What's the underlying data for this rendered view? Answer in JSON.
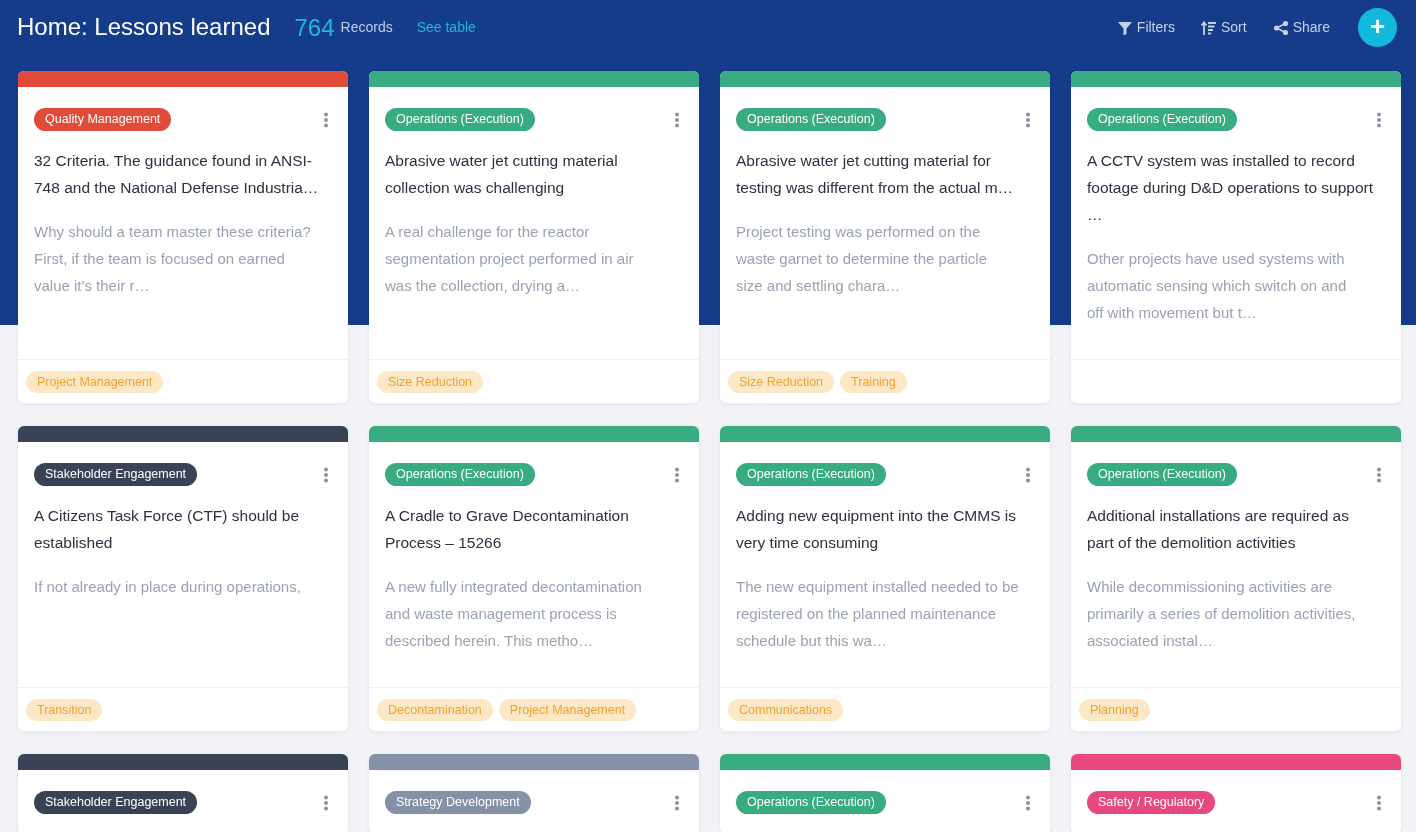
{
  "header": {
    "title": "Home: Lessons learned",
    "count": "764",
    "count_label": "Records",
    "link": "See table"
  },
  "toolbar": [
    {
      "kind": "filter",
      "label": "Filters"
    },
    {
      "kind": "sort",
      "label": "Sort"
    },
    {
      "kind": "share",
      "label": "Share"
    }
  ],
  "add_button": {
    "label": "+"
  },
  "cards": [
    {
      "color": "#e04b3a",
      "category": "Quality Management",
      "title_lines": [
        "32 Criteria. The guidance found in ANSI-",
        "748 and the National Defense Industria…"
      ],
      "description_lines": [
        "Why should a team master these criteria?",
        "First, if the team is focused on earned",
        "value it's their r…"
      ],
      "tags": [
        "Project Management"
      ]
    },
    {
      "color": "#39ab80",
      "category": "Operations (Execution)",
      "title_lines": [
        "Abrasive water jet cutting material",
        "collection was challenging"
      ],
      "description_lines": [
        "A real challenge for the reactor",
        "segmentation project performed in air",
        "was the collection, drying a…"
      ],
      "tags": [
        "Size Reduction"
      ]
    },
    {
      "color": "#39ab80",
      "category": "Operations (Execution)",
      "title_lines": [
        "Abrasive water jet cutting material for",
        "testing was different from the actual m…"
      ],
      "description_lines": [
        "Project testing was performed on the",
        "waste garnet to determine the particle",
        "size and settling chara…"
      ],
      "tags": [
        "Size Reduction",
        "Training"
      ]
    },
    {
      "color": "#39ab80",
      "category": "Operations (Execution)",
      "title_lines": [
        "A CCTV system was installed to record",
        "footage during D&D operations to support",
        "…"
      ],
      "description_lines": [
        "Other projects have used systems with",
        "automatic sensing which switch on and",
        "off with movement but t…"
      ]
    },
    {
      "color": "#3a4356",
      "category": "Stakeholder Engagement",
      "title_lines": [
        "A Citizens Task Force (CTF) should be",
        "established"
      ],
      "description_lines": [
        "If not already in place during operations,"
      ],
      "tags": [
        "Transition"
      ]
    },
    {
      "color": "#39ab80",
      "category": "Operations (Execution)",
      "title_lines": [
        "A Cradle to Grave Decontamination",
        "Process – 15266"
      ],
      "description_lines": [
        "A new fully integrated decontamination",
        "and waste management process is",
        "described herein. This metho…"
      ],
      "tags": [
        "Decontamination",
        "Project Management"
      ]
    },
    {
      "color": "#39ab80",
      "category": "Operations (Execution)",
      "title_lines": [
        "Adding new equipment into the CMMS is",
        "very time consuming"
      ],
      "description_lines": [
        "The new equipment installed needed to be",
        "registered on the planned maintenance",
        "schedule but this wa…"
      ],
      "tags": [
        "Communications"
      ]
    },
    {
      "color": "#39ab80",
      "category": "Operations (Execution)",
      "title_lines": [
        "Additional installations are required as",
        "part of the demolition activities"
      ],
      "description_lines": [
        "While decommissioning activities are",
        "primarily a series of demolition activities,",
        "associated instal…"
      ],
      "tags": [
        "Planning"
      ]
    },
    {
      "color": "#3a4356",
      "category": "Stakeholder Engagement"
    },
    {
      "color": "#8591a6",
      "category": "Strategy Development"
    },
    {
      "color": "#39ab80",
      "category": "Operations (Execution)"
    },
    {
      "color": "#e8497d",
      "category": "Safety / Regulatory"
    }
  ]
}
